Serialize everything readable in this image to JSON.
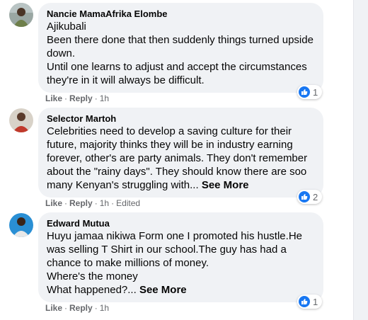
{
  "comments": [
    {
      "author": "Nancie MamaAfrika Elombe",
      "lines": [
        "Ajikubali",
        "Been there done that then suddenly things turned upside",
        "down.",
        "Until one learns to adjust and accept the circumstances",
        "they're in it will always be difficult."
      ],
      "see_more": "",
      "actions": {
        "like": "Like",
        "reply": "Reply",
        "time": "1h",
        "edited": ""
      },
      "reaction_count": "1"
    },
    {
      "author": "Selector Martoh",
      "lines": [
        "Celebrities need to develop a saving culture for their",
        "future, majority thinks they will be in industry earning",
        "forever, other's are party animals. They don't remember",
        "about the \"rainy days\". They should know there are soo",
        "many Kenyan's struggling with..."
      ],
      "see_more": "See More",
      "actions": {
        "like": "Like",
        "reply": "Reply",
        "time": "1h",
        "edited": "Edited"
      },
      "reaction_count": "2"
    },
    {
      "author": "Edward Mutua",
      "lines": [
        "Huyu jamaa nikiwa Form one I promoted his hustle.He",
        "was selling T Shirt in our school.The guy has had a",
        "chance to make millions of money.",
        "Where's the money",
        "What happened?..."
      ],
      "see_more": "See More",
      "actions": {
        "like": "Like",
        "reply": "Reply",
        "time": "1h",
        "edited": ""
      },
      "reaction_count": "1"
    }
  ],
  "colors": {
    "bubble": "#f0f2f5",
    "like_blue": "#1877f2",
    "meta_gray": "#65676b"
  }
}
